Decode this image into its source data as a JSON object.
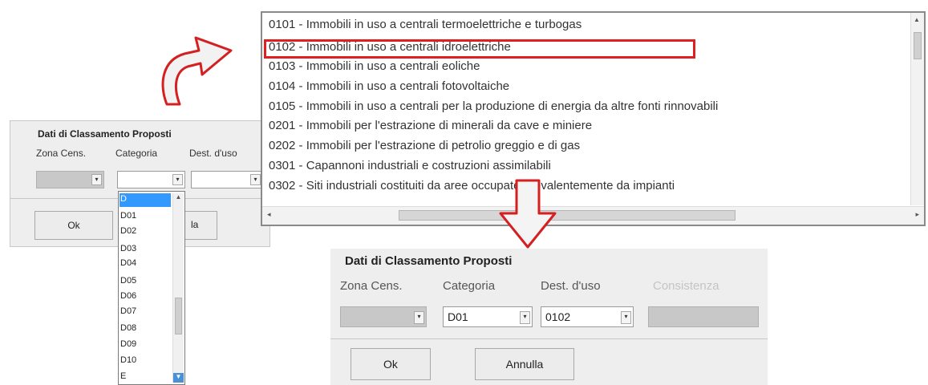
{
  "top_panel": {
    "title": "Dati di Classamento Proposti",
    "labels": {
      "zona": "Zona Cens.",
      "categoria": "Categoria",
      "dest": "Dest. d'uso"
    },
    "ok": "Ok",
    "annulla_partial": "la"
  },
  "categoria_dropdown": {
    "items": [
      "D",
      "D01",
      "D02",
      "D03",
      "D04",
      "D05",
      "D06",
      "D07",
      "D08",
      "D09",
      "D10",
      "E"
    ],
    "selected": "D"
  },
  "dest_list": {
    "items": [
      "0101 - Immobili in uso a centrali termoelettriche e turbogas",
      "0102 - Immobili in uso a centrali idroelettriche",
      "0103 - Immobili in uso a centrali eoliche",
      "0104 - Immobili in uso a centrali fotovoltaiche",
      "0105 - Immobili in uso a centrali per la produzione di energia da altre fonti rinnovabili",
      "0201 - Immobili per l'estrazione di minerali da cave e miniere",
      "0202 - Immobili per l'estrazione di petrolio greggio e di gas",
      "0301 - Capannoni industriali e costruzioni assimilabili",
      "0302 - Siti industriali costituiti da aree occupate prevalentemente da impianti"
    ],
    "highlighted": "0102 - Immobili in uso a centrali idroelettriche"
  },
  "bottom_panel": {
    "title": "Dati di Classamento Proposti",
    "labels": {
      "zona": "Zona Cens.",
      "categoria": "Categoria",
      "dest": "Dest. d'uso",
      "consistenza": "Consistenza"
    },
    "values": {
      "categoria": "D01",
      "dest": "0102"
    },
    "ok": "Ok",
    "annulla": "Annulla"
  },
  "colors": {
    "highlight_box": "#e02020",
    "selection": "#3399ff",
    "arrow": "#d42020"
  },
  "icons": [
    "curved-arrow-icon",
    "down-arrow-icon",
    "chevron-down-icon"
  ]
}
